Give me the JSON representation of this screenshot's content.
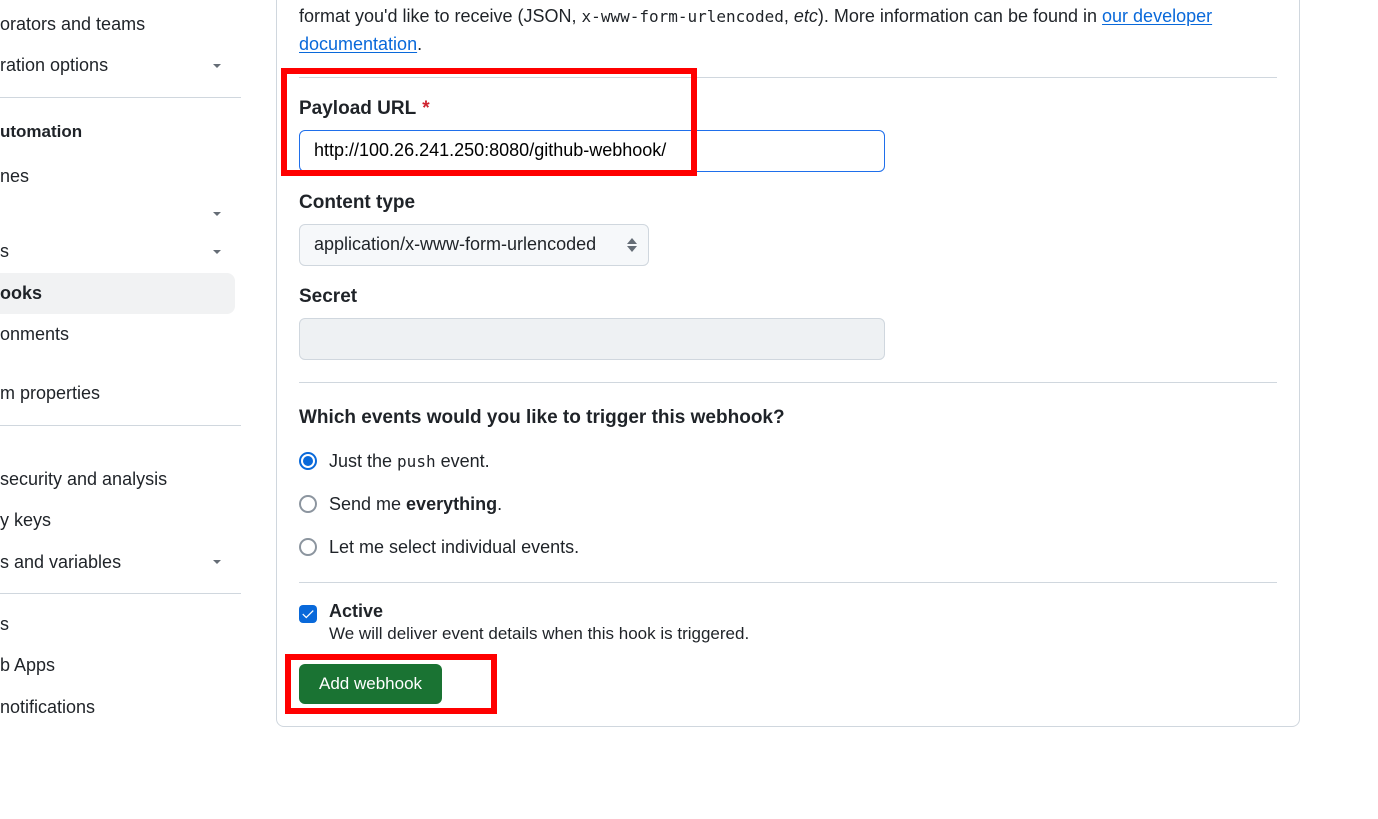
{
  "sidebar": {
    "items": [
      {
        "label": "orators and teams",
        "chev": false
      },
      {
        "label": "ration options",
        "chev": true
      }
    ],
    "heading": "utomation",
    "items2": [
      {
        "label": "nes",
        "chev": false
      },
      {
        "label": "",
        "chev": true
      },
      {
        "label": "s",
        "chev": true
      },
      {
        "label": "ooks",
        "chev": false,
        "active": true
      },
      {
        "label": "onments",
        "chev": false
      },
      {
        "label": "",
        "chev": false
      },
      {
        "label": "m properties",
        "chev": false
      }
    ],
    "items3": [
      {
        "label": "security and analysis",
        "chev": false
      },
      {
        "label": "y keys",
        "chev": false
      },
      {
        "label": "s and variables",
        "chev": true
      }
    ],
    "items4": [
      {
        "label": "s",
        "chev": false
      },
      {
        "label": "b Apps",
        "chev": false
      },
      {
        "label": "notifications",
        "chev": false
      }
    ]
  },
  "intro": {
    "line": "format you'd like to receive (JSON, ",
    "code": "x-www-form-urlencoded",
    "after": ", ",
    "etc": "etc",
    "after2": "). More information can be found in ",
    "link": "our developer documentation",
    "period": "."
  },
  "form": {
    "payload_label": "Payload URL",
    "payload_value": "http://100.26.241.250:8080/github-webhook/",
    "content_type_label": "Content type",
    "content_type_value": "application/x-www-form-urlencoded",
    "secret_label": "Secret",
    "events_question": "Which events would you like to trigger this webhook?",
    "radio_push_pre": "Just the ",
    "radio_push_code": "push",
    "radio_push_post": " event.",
    "radio_everything_pre": "Send me ",
    "radio_everything_bold": "everything",
    "radio_everything_post": ".",
    "radio_individual": "Let me select individual events.",
    "active_label": "Active",
    "active_sub": "We will deliver event details when this hook is triggered.",
    "submit": "Add webhook"
  }
}
